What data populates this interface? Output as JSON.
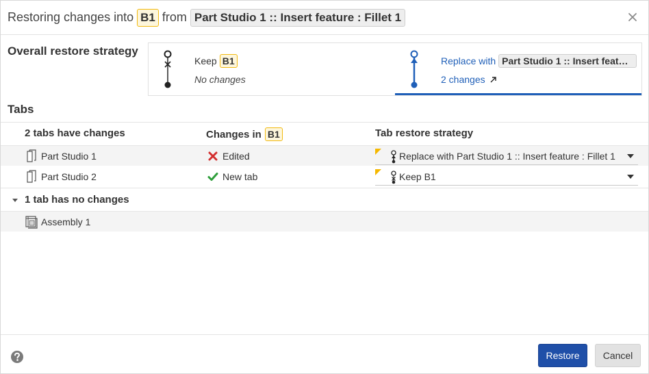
{
  "header": {
    "prefix": "Restoring changes into",
    "version": "B1",
    "from_label": "from",
    "source": "Part Studio 1 :: Insert feature : Fillet 1"
  },
  "strategy": {
    "label": "Overall restore strategy",
    "keep": {
      "label": "Keep",
      "version": "B1",
      "detail": "No changes"
    },
    "replace": {
      "label": "Replace with",
      "source": "Part Studio 1 :: Insert feature : Fillet 1",
      "changes_link": "2 changes",
      "selected": true
    }
  },
  "tabs": {
    "title": "Tabs",
    "columns": {
      "changed_count": "2 tabs have changes",
      "changes_in": "Changes in",
      "changes_in_version": "B1",
      "strategy": "Tab restore strategy"
    },
    "changed_rows": [
      {
        "name": "Part Studio 1",
        "status": "Edited",
        "status_icon": "x-icon",
        "strategy": "Replace with Part Studio 1 :: Insert feature : Fillet 1"
      },
      {
        "name": "Part Studio 2",
        "status": "New tab",
        "status_icon": "check-icon",
        "strategy": "Keep B1"
      }
    ],
    "unchanged_header": "1 tab has no changes",
    "unchanged_rows": [
      {
        "name": "Assembly 1"
      }
    ]
  },
  "footer": {
    "restore_label": "Restore",
    "cancel_label": "Cancel"
  },
  "colors": {
    "accent": "#1f5fb8",
    "primary_button": "#1f4fa8",
    "version_badge_border": "#f2b90f",
    "error_red": "#d32f2f",
    "success_green": "#2e9e3a"
  }
}
